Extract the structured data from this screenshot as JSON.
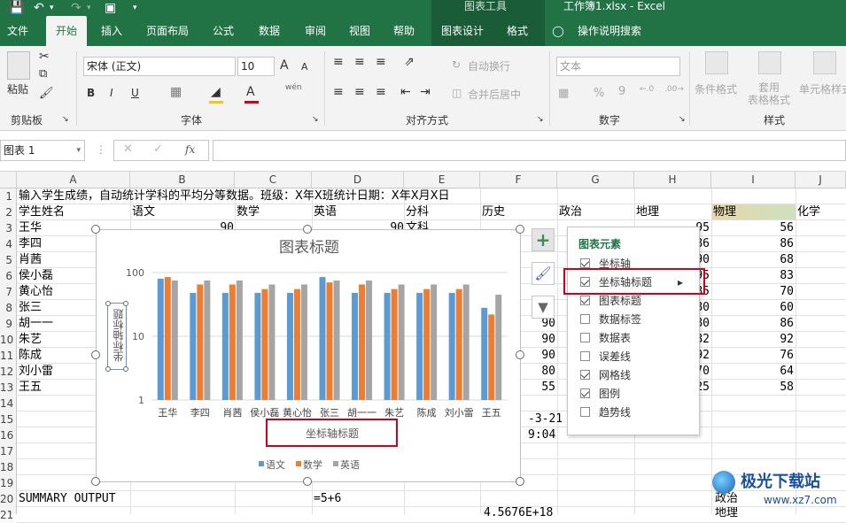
{
  "titlebar": {
    "context_label": "图表工具",
    "window_title": "工作簿1.xlsx  -  Excel"
  },
  "tabs": [
    {
      "label": "文件"
    },
    {
      "label": "开始"
    },
    {
      "label": "插入"
    },
    {
      "label": "页面布局"
    },
    {
      "label": "公式"
    },
    {
      "label": "数据"
    },
    {
      "label": "审阅"
    },
    {
      "label": "视图"
    },
    {
      "label": "帮助"
    },
    {
      "label": "图表设计"
    },
    {
      "label": "格式"
    }
  ],
  "tell_me": "操作说明搜索",
  "ribbon": {
    "paste": "粘贴",
    "font_name": "宋体 (正文)",
    "font_size": "10",
    "font_grow": "A",
    "font_shrink": "A",
    "bold": "B",
    "italic": "I",
    "underline": "U",
    "wen": "wén",
    "wrap_text": "自动换行",
    "merge_center": "合并后居中",
    "number_format": "文本",
    "percent": "%",
    "comma": "9",
    "dec_inc": "←.0",
    "dec_dec": ".00→",
    "cond_format": "条件格式",
    "table_format": "套用\n表格格式",
    "cell_style": "单元格样式",
    "groups": {
      "clipboard": "剪贴板",
      "font": "字体",
      "alignment": "对齐方式",
      "number": "数字",
      "styles": "样式"
    }
  },
  "formula_bar": {
    "name_box": "图表 1",
    "fx": "fx"
  },
  "columns": [
    "A",
    "B",
    "C",
    "D",
    "E",
    "F",
    "G",
    "H",
    "I",
    "J"
  ],
  "rows": [
    "1",
    "2",
    "3",
    "4",
    "5",
    "6",
    "7",
    "8",
    "9",
    "10",
    "11",
    "12",
    "13",
    "14",
    "15",
    "16",
    "17",
    "18",
    "19",
    "20",
    "21"
  ],
  "cells": {
    "r1": "输入学生成绩，自动统计学科的平均分等数据。班级：X年X班统计日期：X年X月X日",
    "r2": [
      "学生姓名",
      "语文",
      "数学",
      "英语",
      "分科",
      "历史",
      "政治",
      "地理",
      "物理",
      "化学"
    ],
    "names": [
      "王华",
      "李四",
      "肖茜",
      "侯小磊",
      "黄心怡",
      "张三",
      "胡一一",
      "朱艺",
      "陈成",
      "刘小雷",
      "王五"
    ],
    "history_visible": [
      "90",
      "90",
      "90",
      "80",
      "55"
    ],
    "geo_visible": [
      "95",
      "86",
      "90",
      "95",
      "85",
      "80",
      "80",
      "82",
      "92",
      "70",
      "25"
    ],
    "physics": [
      "56",
      "86",
      "68",
      "83",
      "70",
      "60",
      "86",
      "92",
      "76",
      "64",
      "58"
    ],
    "r3_partial_b": "90",
    "r3_partial_d": "90",
    "r3_e": "文科",
    "r15_f": "-3-21",
    "r16_f": "9:04",
    "r20_a": "SUMMARY  OUTPUT",
    "r20_d": "=5+6",
    "r20_h": "政治",
    "r21_f": "4.5676E+18",
    "r21_h": "地理"
  },
  "chart_data": {
    "type": "bar",
    "title": "图表标题",
    "xlabel": "坐标轴标题",
    "ylabel": "坐标轴标题",
    "yscale": "log",
    "ylim": [
      1,
      100
    ],
    "yticks": [
      "1",
      "10",
      "100"
    ],
    "categories": [
      "王华",
      "李四",
      "肖茜",
      "侯小磊",
      "黄心怡",
      "张三",
      "胡一一",
      "朱艺",
      "陈成",
      "刘小雷",
      "王五"
    ],
    "series": [
      {
        "name": "语文",
        "color": "#5b9bd5",
        "values": [
          80,
          48,
          48,
          48,
          48,
          85,
          48,
          48,
          48,
          48,
          28
        ]
      },
      {
        "name": "数学",
        "color": "#ed7d31",
        "values": [
          85,
          65,
          65,
          55,
          55,
          70,
          65,
          55,
          55,
          55,
          22
        ]
      },
      {
        "name": "英语",
        "color": "#a5a5a5",
        "values": [
          75,
          75,
          75,
          65,
          65,
          75,
          75,
          65,
          65,
          65,
          45
        ]
      }
    ],
    "grid": true,
    "legend": "bottom"
  },
  "panel": {
    "title": "图表元素",
    "items": [
      {
        "label": "坐标轴",
        "checked": true
      },
      {
        "label": "坐标轴标题",
        "checked": true,
        "submenu": true
      },
      {
        "label": "图表标题",
        "checked": true
      },
      {
        "label": "数据标签",
        "checked": false
      },
      {
        "label": "数据表",
        "checked": false
      },
      {
        "label": "误差线",
        "checked": false
      },
      {
        "label": "网格线",
        "checked": true
      },
      {
        "label": "图例",
        "checked": true
      },
      {
        "label": "趋势线",
        "checked": false
      }
    ]
  },
  "watermark": {
    "brand": "极光下载站",
    "url": "www.xz7.com"
  },
  "colors": {
    "excel_green": "#217346",
    "highlight_red": "#d0021b",
    "physics_header_fill": "#e6d7a8"
  }
}
